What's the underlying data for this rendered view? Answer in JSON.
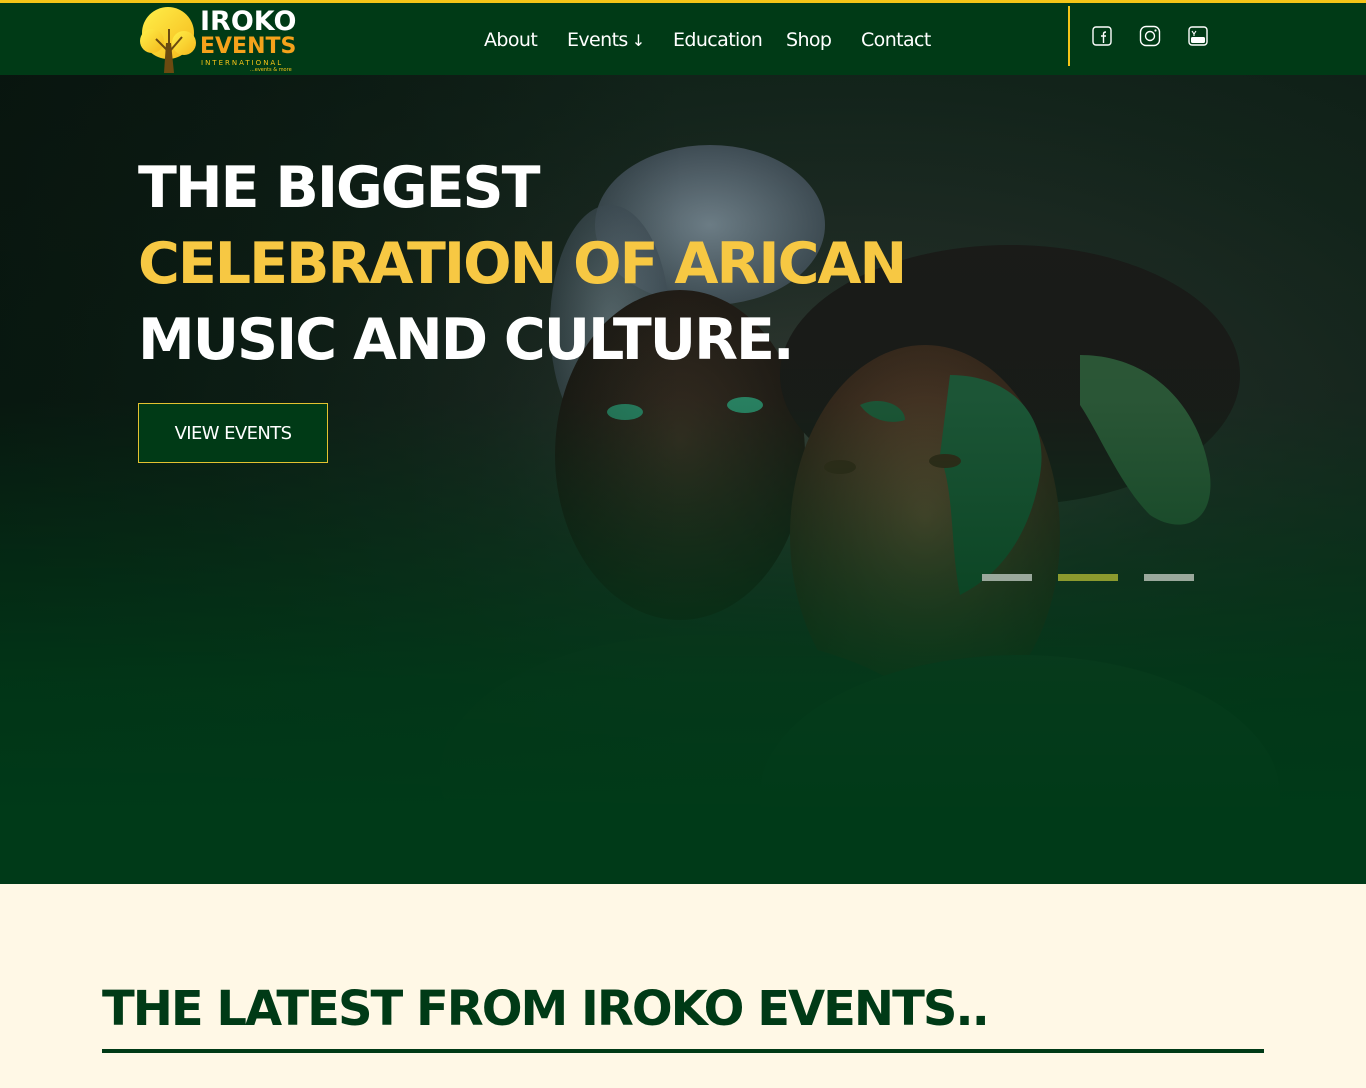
{
  "header": {
    "logo": {
      "line1": "IROKO",
      "line2": "EVENTS",
      "line3": "INTERNATIONAL",
      "tagline": "...events & more"
    },
    "nav": [
      {
        "label": "About"
      },
      {
        "label": "Events",
        "arrow": "↓"
      },
      {
        "label": "Education"
      },
      {
        "label": "Shop"
      },
      {
        "label": "Contact"
      }
    ],
    "social": [
      "facebook-icon",
      "instagram-icon",
      "youtube-icon"
    ]
  },
  "hero": {
    "headline_line1": "THE BIGGEST",
    "headline_line2": "CELEBRATION OF ARICAN",
    "headline_line3": "MUSIC AND CULTURE.",
    "cta_label": "VIEW EVENTS",
    "slides": 3,
    "active_slide": 2
  },
  "latest": {
    "title": "THE LATEST FROM IROKO EVENTS.."
  },
  "colors": {
    "brand_green": "#003a16",
    "accent_yellow": "#f5c518",
    "headline_yellow": "#f7c843",
    "cream": "#fff8e6",
    "dot_inactive": "#9aa89c",
    "dot_active": "#8c9a2e"
  }
}
